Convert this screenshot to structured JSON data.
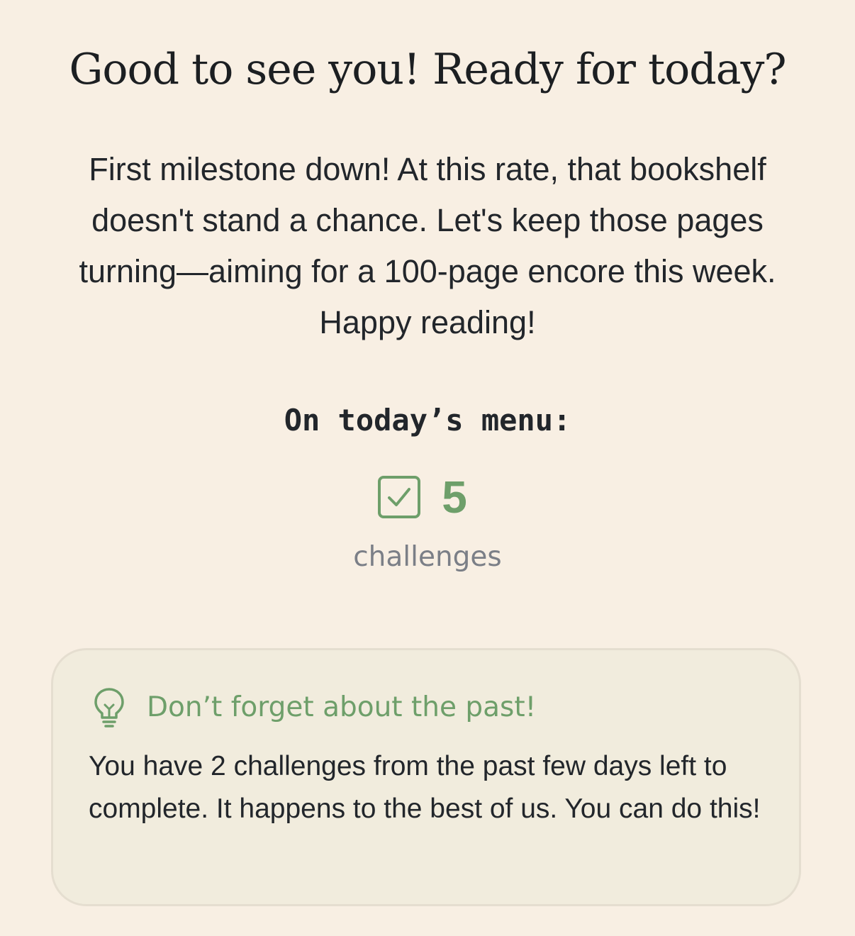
{
  "greeting": "Good to see you! Ready for today?",
  "intro": "First milestone down! At this rate, that bookshelf doesn't stand a chance. Let's keep those pages turning—aiming for a 100-page encore this week. Happy reading!",
  "menu": {
    "heading": "On today’s menu:",
    "icon": "checkbox-checked-icon",
    "count": "5",
    "count_label": "challenges"
  },
  "reminder": {
    "icon": "lightbulb-icon",
    "title": "Don’t forget about the past!",
    "body": "You have 2 challenges from the past few days left to complete. It happens to the best of us. You can do this!"
  },
  "colors": {
    "background": "#f8efe3",
    "accent": "#6e9f6a",
    "card_background": "#f1ecdd",
    "muted_text": "#7b7f87"
  }
}
